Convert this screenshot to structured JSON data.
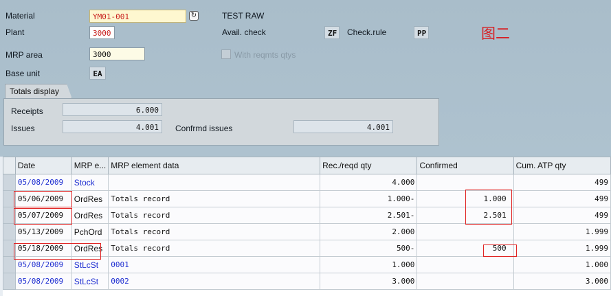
{
  "header": {
    "material_label": "Material",
    "material_value": "YM01-001",
    "material_desc": "TEST RAW",
    "plant_label": "Plant",
    "plant_value": "3000",
    "mrp_area_label": "MRP area",
    "mrp_area_value": "3000",
    "base_unit_label": "Base unit",
    "base_unit_value": "EA",
    "avail_check_label": "Avail. check",
    "avail_check_value": "ZF",
    "check_rule_label": "Check.rule",
    "check_rule_value": "PP",
    "with_reqmts_label": "With reqmts qtys",
    "figure_tag": "图二"
  },
  "totals": {
    "tab_label": "Totals display",
    "receipts_label": "Receipts",
    "receipts_value": "6.000",
    "issues_label": "Issues",
    "issues_value": "4.001",
    "confirmed_issues_label": "Confrmd issues",
    "confirmed_issues_value": "4.001"
  },
  "table": {
    "columns": [
      "Date",
      "MRP e...",
      "MRP element data",
      "Rec./reqd qty",
      "Confirmed",
      "Cum. ATP qty"
    ],
    "rows": [
      {
        "date": "05/08/2009",
        "element": "Stock",
        "data": "",
        "qty": "4.000",
        "confirmed": "",
        "cum": "499",
        "link": true
      },
      {
        "date": "05/06/2009",
        "element": "OrdRes",
        "data": "Totals record",
        "qty": "1.000-",
        "confirmed": "1.000",
        "cum": "499",
        "link": false
      },
      {
        "date": "05/07/2009",
        "element": "OrdRes",
        "data": "Totals record",
        "qty": "2.501-",
        "confirmed": "2.501",
        "cum": "499",
        "link": false
      },
      {
        "date": "05/13/2009",
        "element": "PchOrd",
        "data": "Totals record",
        "qty": "2.000",
        "confirmed": "",
        "cum": "1.999",
        "link": false
      },
      {
        "date": "05/18/2009",
        "element": "OrdRes",
        "data": "Totals record",
        "qty": "500-",
        "confirmed": "500",
        "cum": "1.999",
        "link": false
      },
      {
        "date": "05/08/2009",
        "element": "StLcSt",
        "data": "0001",
        "qty": "1.000",
        "confirmed": "",
        "cum": "1.000",
        "link": true
      },
      {
        "date": "05/08/2009",
        "element": "StLcSt",
        "data": "0002",
        "qty": "3.000",
        "confirmed": "",
        "cum": "3.000",
        "link": true
      }
    ]
  },
  "colors": {
    "header_bg": "#aabecb",
    "link": "#1f2fd1",
    "highlight_box": "#e02525"
  }
}
